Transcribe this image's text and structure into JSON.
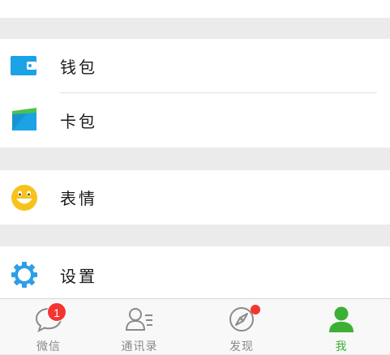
{
  "menu": {
    "top_partial_item": {
      "icon": "album-icon"
    },
    "items": [
      {
        "key": "wallet",
        "label": "钱包",
        "icon": "wallet-icon",
        "color": "#1ba3e6"
      },
      {
        "key": "cards",
        "label": "卡包",
        "icon": "card-icon",
        "color": "#1ba3e6"
      },
      {
        "key": "sticker",
        "label": "表情",
        "icon": "smiley-icon",
        "color": "#f7c21a"
      },
      {
        "key": "settings",
        "label": "设置",
        "icon": "gear-icon",
        "color": "#2c9fe8"
      }
    ]
  },
  "tabbar": {
    "tabs": [
      {
        "label": "微信",
        "icon": "chat-bubble-icon",
        "badge": "1"
      },
      {
        "label": "通讯录",
        "icon": "contacts-icon"
      },
      {
        "label": "发现",
        "icon": "compass-icon",
        "dot": true
      },
      {
        "label": "我",
        "icon": "person-icon",
        "active": true
      }
    ],
    "active_color": "#3cb034",
    "inactive_color": "#8a8a8a"
  }
}
